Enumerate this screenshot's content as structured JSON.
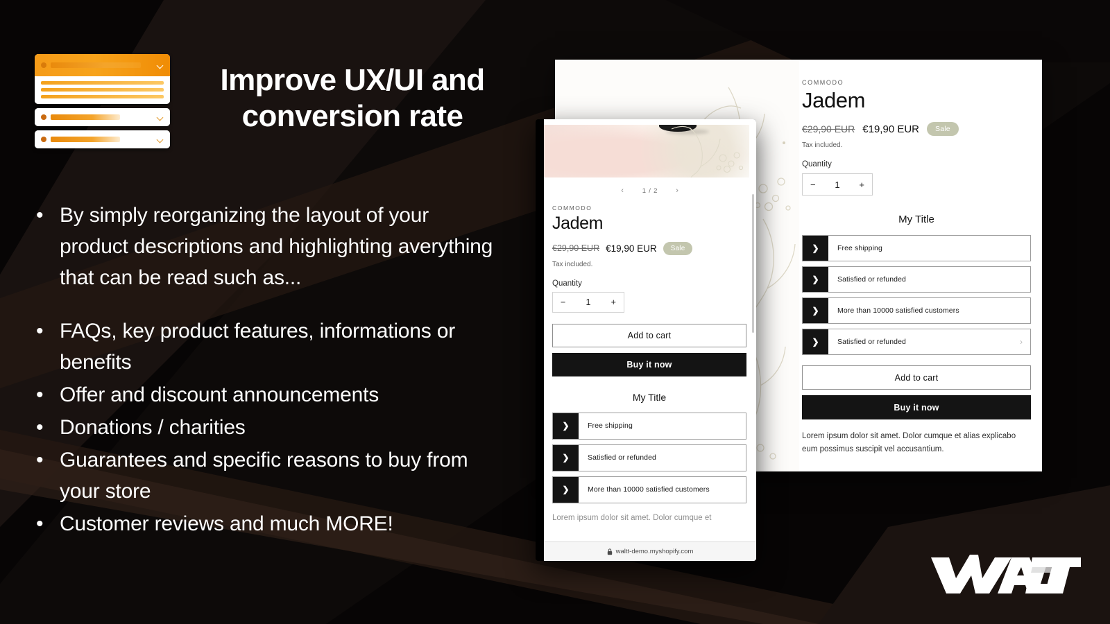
{
  "slide": {
    "headline": "Improve UX/UI and conversion rate",
    "bullets_group1": [
      "By simply reorganizing the layout of your product descriptions and highlighting averything that can be read such as..."
    ],
    "bullets_group2": [
      "FAQs, key product features, informations or benefits",
      "Offer and discount announcements",
      "Donations / charities",
      "Guarantees and specific reasons to buy from your store",
      "Customer reviews and much MORE!"
    ],
    "bullet_marker": "•",
    "brand_logo": "WALTT"
  },
  "colors": {
    "background": "#070505",
    "accent_orange": "#f59b18",
    "accent_orange_dark": "#e07d08",
    "sale_badge": "#c3c6ae",
    "panel_dark": "#141414",
    "diagonal_brown": "#211610"
  },
  "widget": {
    "name": "orange-accordion-widget-mock",
    "cards": [
      {
        "expanded": true,
        "lines": 3
      },
      {
        "expanded": false,
        "lines": 0
      },
      {
        "expanded": false,
        "lines": 0
      }
    ],
    "chevron_icon": "chevron-down-icon"
  },
  "desktop_panel": {
    "vendor": "COMMODO",
    "title": "Jadem",
    "price_old": "€29,90 EUR",
    "price_new": "€19,90 EUR",
    "sale_label": "Sale",
    "tax_note": "Tax included.",
    "quantity_label": "Quantity",
    "quantity_value": "1",
    "quantity_minus": "−",
    "quantity_plus": "+",
    "section_title": "My Title",
    "accordion": [
      {
        "label": "Free shipping",
        "icon": "chevron-right-icon",
        "end_icon": ""
      },
      {
        "label": "Satisfied or refunded",
        "icon": "chevron-right-icon",
        "end_icon": ""
      },
      {
        "label": "More than 10000 satisfied customers",
        "icon": "chevron-right-icon",
        "end_icon": ""
      },
      {
        "label": "Satisfied or refunded",
        "icon": "chevron-right-icon",
        "end_icon": "›"
      }
    ],
    "add_to_cart": "Add to cart",
    "buy_it_now": "Buy it now",
    "description": "Lorem ipsum dolor sit amet. Dolor cumque et alias explicabo eum possimus suscipit vel accusantium."
  },
  "mobile_panel": {
    "pager_prev": "‹",
    "pager_text": "1 / 2",
    "pager_next": "›",
    "vendor": "COMMODO",
    "title": "Jadem",
    "price_old": "€29,90 EUR",
    "price_new": "€19,90 EUR",
    "sale_label": "Sale",
    "tax_note": "Tax included.",
    "quantity_label": "Quantity",
    "quantity_value": "1",
    "quantity_minus": "−",
    "quantity_plus": "+",
    "add_to_cart": "Add to cart",
    "buy_it_now": "Buy it now",
    "section_title": "My Title",
    "accordion": [
      {
        "label": "Free shipping",
        "icon": "chevron-right-icon"
      },
      {
        "label": "Satisfied or refunded",
        "icon": "chevron-right-icon"
      },
      {
        "label": "More than 10000 satisfied customers",
        "icon": "chevron-right-icon"
      }
    ],
    "description_clipped": "Lorem ipsum dolor sit amet. Dolor cumque et",
    "url": "waltt-demo.myshopify.com",
    "lock_icon": "lock-icon"
  }
}
